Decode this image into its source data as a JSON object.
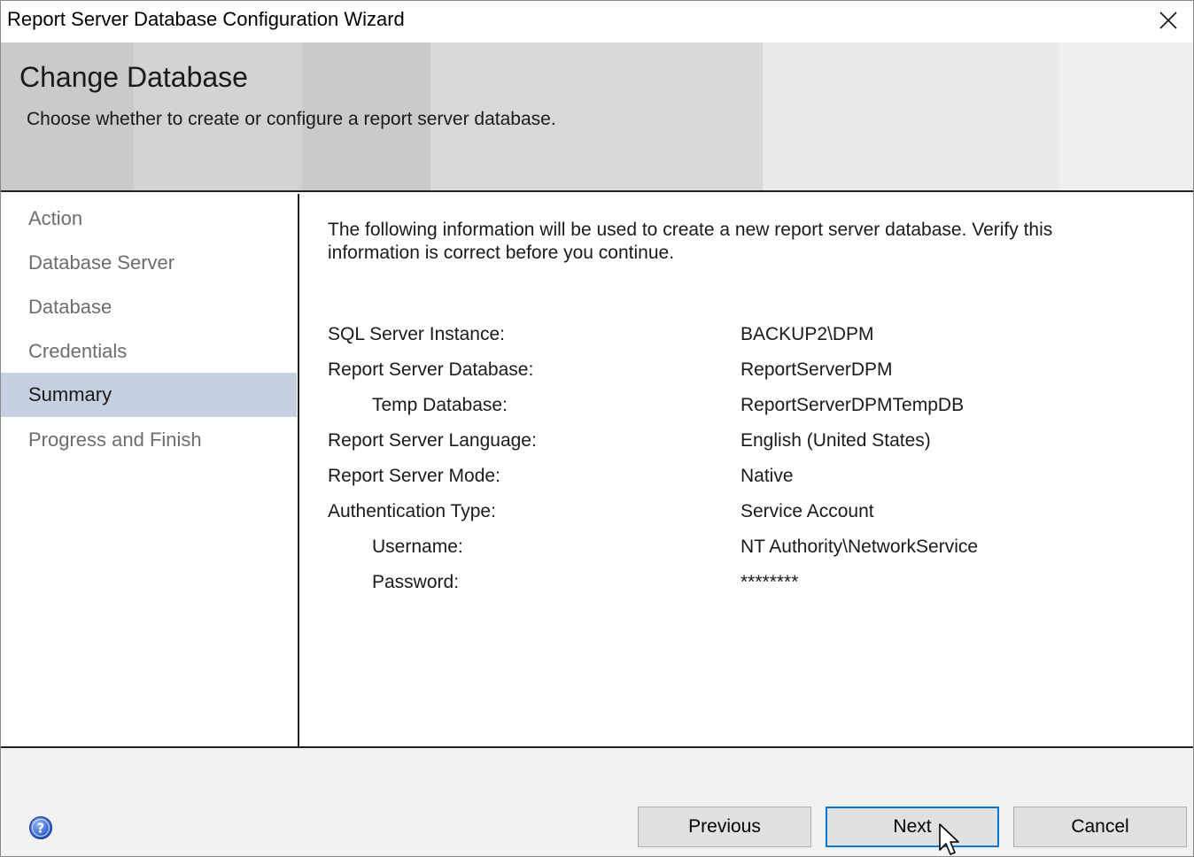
{
  "window": {
    "title": "Report Server Database Configuration Wizard"
  },
  "banner": {
    "heading": "Change Database",
    "subheading": "Choose whether to create or configure a report server database."
  },
  "nav": {
    "steps": [
      {
        "label": "Action"
      },
      {
        "label": "Database Server"
      },
      {
        "label": "Database"
      },
      {
        "label": "Credentials"
      },
      {
        "label": "Summary",
        "active": true
      },
      {
        "label": "Progress and Finish"
      }
    ]
  },
  "summary": {
    "intro": "The following information will be used to create a new report server database. Verify this information is correct before you continue.",
    "rows": [
      {
        "label": "SQL Server Instance:",
        "value": "BACKUP2\\DPM"
      },
      {
        "label": "Report Server Database:",
        "value": "ReportServerDPM"
      },
      {
        "label": "Temp Database:",
        "value": "ReportServerDPMTempDB"
      },
      {
        "label": "Report Server Language:",
        "value": "English (United States)"
      },
      {
        "label": "Report Server Mode:",
        "value": "Native"
      },
      {
        "label": "Authentication Type:",
        "value": "Service Account"
      },
      {
        "label": "Username:",
        "value": "NT Authority\\NetworkService"
      },
      {
        "label": "Password:",
        "value": "********"
      }
    ]
  },
  "footer": {
    "previous_label": "Previous",
    "next_label": "Next",
    "cancel_label": "Cancel"
  },
  "icons": {
    "close": "close-icon",
    "help": "help-icon",
    "cursor": "mouse-pointer-icon"
  },
  "colors": {
    "active_step_bg": "#c5d0e0",
    "default_button_border": "#0078d7",
    "inactive_step_text": "#6d6d6d"
  }
}
